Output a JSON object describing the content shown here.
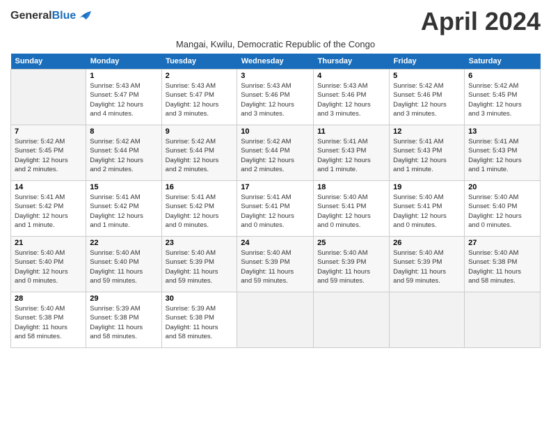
{
  "header": {
    "logo_general": "General",
    "logo_blue": "Blue",
    "month_year": "April 2024",
    "subtitle": "Mangai, Kwilu, Democratic Republic of the Congo"
  },
  "calendar": {
    "days_of_week": [
      "Sunday",
      "Monday",
      "Tuesday",
      "Wednesday",
      "Thursday",
      "Friday",
      "Saturday"
    ],
    "weeks": [
      [
        {
          "day": "",
          "info": ""
        },
        {
          "day": "1",
          "info": "Sunrise: 5:43 AM\nSunset: 5:47 PM\nDaylight: 12 hours\nand 4 minutes."
        },
        {
          "day": "2",
          "info": "Sunrise: 5:43 AM\nSunset: 5:47 PM\nDaylight: 12 hours\nand 3 minutes."
        },
        {
          "day": "3",
          "info": "Sunrise: 5:43 AM\nSunset: 5:46 PM\nDaylight: 12 hours\nand 3 minutes."
        },
        {
          "day": "4",
          "info": "Sunrise: 5:43 AM\nSunset: 5:46 PM\nDaylight: 12 hours\nand 3 minutes."
        },
        {
          "day": "5",
          "info": "Sunrise: 5:42 AM\nSunset: 5:46 PM\nDaylight: 12 hours\nand 3 minutes."
        },
        {
          "day": "6",
          "info": "Sunrise: 5:42 AM\nSunset: 5:45 PM\nDaylight: 12 hours\nand 3 minutes."
        }
      ],
      [
        {
          "day": "7",
          "info": "Sunrise: 5:42 AM\nSunset: 5:45 PM\nDaylight: 12 hours\nand 2 minutes."
        },
        {
          "day": "8",
          "info": "Sunrise: 5:42 AM\nSunset: 5:44 PM\nDaylight: 12 hours\nand 2 minutes."
        },
        {
          "day": "9",
          "info": "Sunrise: 5:42 AM\nSunset: 5:44 PM\nDaylight: 12 hours\nand 2 minutes."
        },
        {
          "day": "10",
          "info": "Sunrise: 5:42 AM\nSunset: 5:44 PM\nDaylight: 12 hours\nand 2 minutes."
        },
        {
          "day": "11",
          "info": "Sunrise: 5:41 AM\nSunset: 5:43 PM\nDaylight: 12 hours\nand 1 minute."
        },
        {
          "day": "12",
          "info": "Sunrise: 5:41 AM\nSunset: 5:43 PM\nDaylight: 12 hours\nand 1 minute."
        },
        {
          "day": "13",
          "info": "Sunrise: 5:41 AM\nSunset: 5:43 PM\nDaylight: 12 hours\nand 1 minute."
        }
      ],
      [
        {
          "day": "14",
          "info": "Sunrise: 5:41 AM\nSunset: 5:42 PM\nDaylight: 12 hours\nand 1 minute."
        },
        {
          "day": "15",
          "info": "Sunrise: 5:41 AM\nSunset: 5:42 PM\nDaylight: 12 hours\nand 1 minute."
        },
        {
          "day": "16",
          "info": "Sunrise: 5:41 AM\nSunset: 5:42 PM\nDaylight: 12 hours\nand 0 minutes."
        },
        {
          "day": "17",
          "info": "Sunrise: 5:41 AM\nSunset: 5:41 PM\nDaylight: 12 hours\nand 0 minutes."
        },
        {
          "day": "18",
          "info": "Sunrise: 5:40 AM\nSunset: 5:41 PM\nDaylight: 12 hours\nand 0 minutes."
        },
        {
          "day": "19",
          "info": "Sunrise: 5:40 AM\nSunset: 5:41 PM\nDaylight: 12 hours\nand 0 minutes."
        },
        {
          "day": "20",
          "info": "Sunrise: 5:40 AM\nSunset: 5:40 PM\nDaylight: 12 hours\nand 0 minutes."
        }
      ],
      [
        {
          "day": "21",
          "info": "Sunrise: 5:40 AM\nSunset: 5:40 PM\nDaylight: 12 hours\nand 0 minutes."
        },
        {
          "day": "22",
          "info": "Sunrise: 5:40 AM\nSunset: 5:40 PM\nDaylight: 11 hours\nand 59 minutes."
        },
        {
          "day": "23",
          "info": "Sunrise: 5:40 AM\nSunset: 5:39 PM\nDaylight: 11 hours\nand 59 minutes."
        },
        {
          "day": "24",
          "info": "Sunrise: 5:40 AM\nSunset: 5:39 PM\nDaylight: 11 hours\nand 59 minutes."
        },
        {
          "day": "25",
          "info": "Sunrise: 5:40 AM\nSunset: 5:39 PM\nDaylight: 11 hours\nand 59 minutes."
        },
        {
          "day": "26",
          "info": "Sunrise: 5:40 AM\nSunset: 5:39 PM\nDaylight: 11 hours\nand 59 minutes."
        },
        {
          "day": "27",
          "info": "Sunrise: 5:40 AM\nSunset: 5:38 PM\nDaylight: 11 hours\nand 58 minutes."
        }
      ],
      [
        {
          "day": "28",
          "info": "Sunrise: 5:40 AM\nSunset: 5:38 PM\nDaylight: 11 hours\nand 58 minutes."
        },
        {
          "day": "29",
          "info": "Sunrise: 5:39 AM\nSunset: 5:38 PM\nDaylight: 11 hours\nand 58 minutes."
        },
        {
          "day": "30",
          "info": "Sunrise: 5:39 AM\nSunset: 5:38 PM\nDaylight: 11 hours\nand 58 minutes."
        },
        {
          "day": "",
          "info": ""
        },
        {
          "day": "",
          "info": ""
        },
        {
          "day": "",
          "info": ""
        },
        {
          "day": "",
          "info": ""
        }
      ]
    ]
  }
}
